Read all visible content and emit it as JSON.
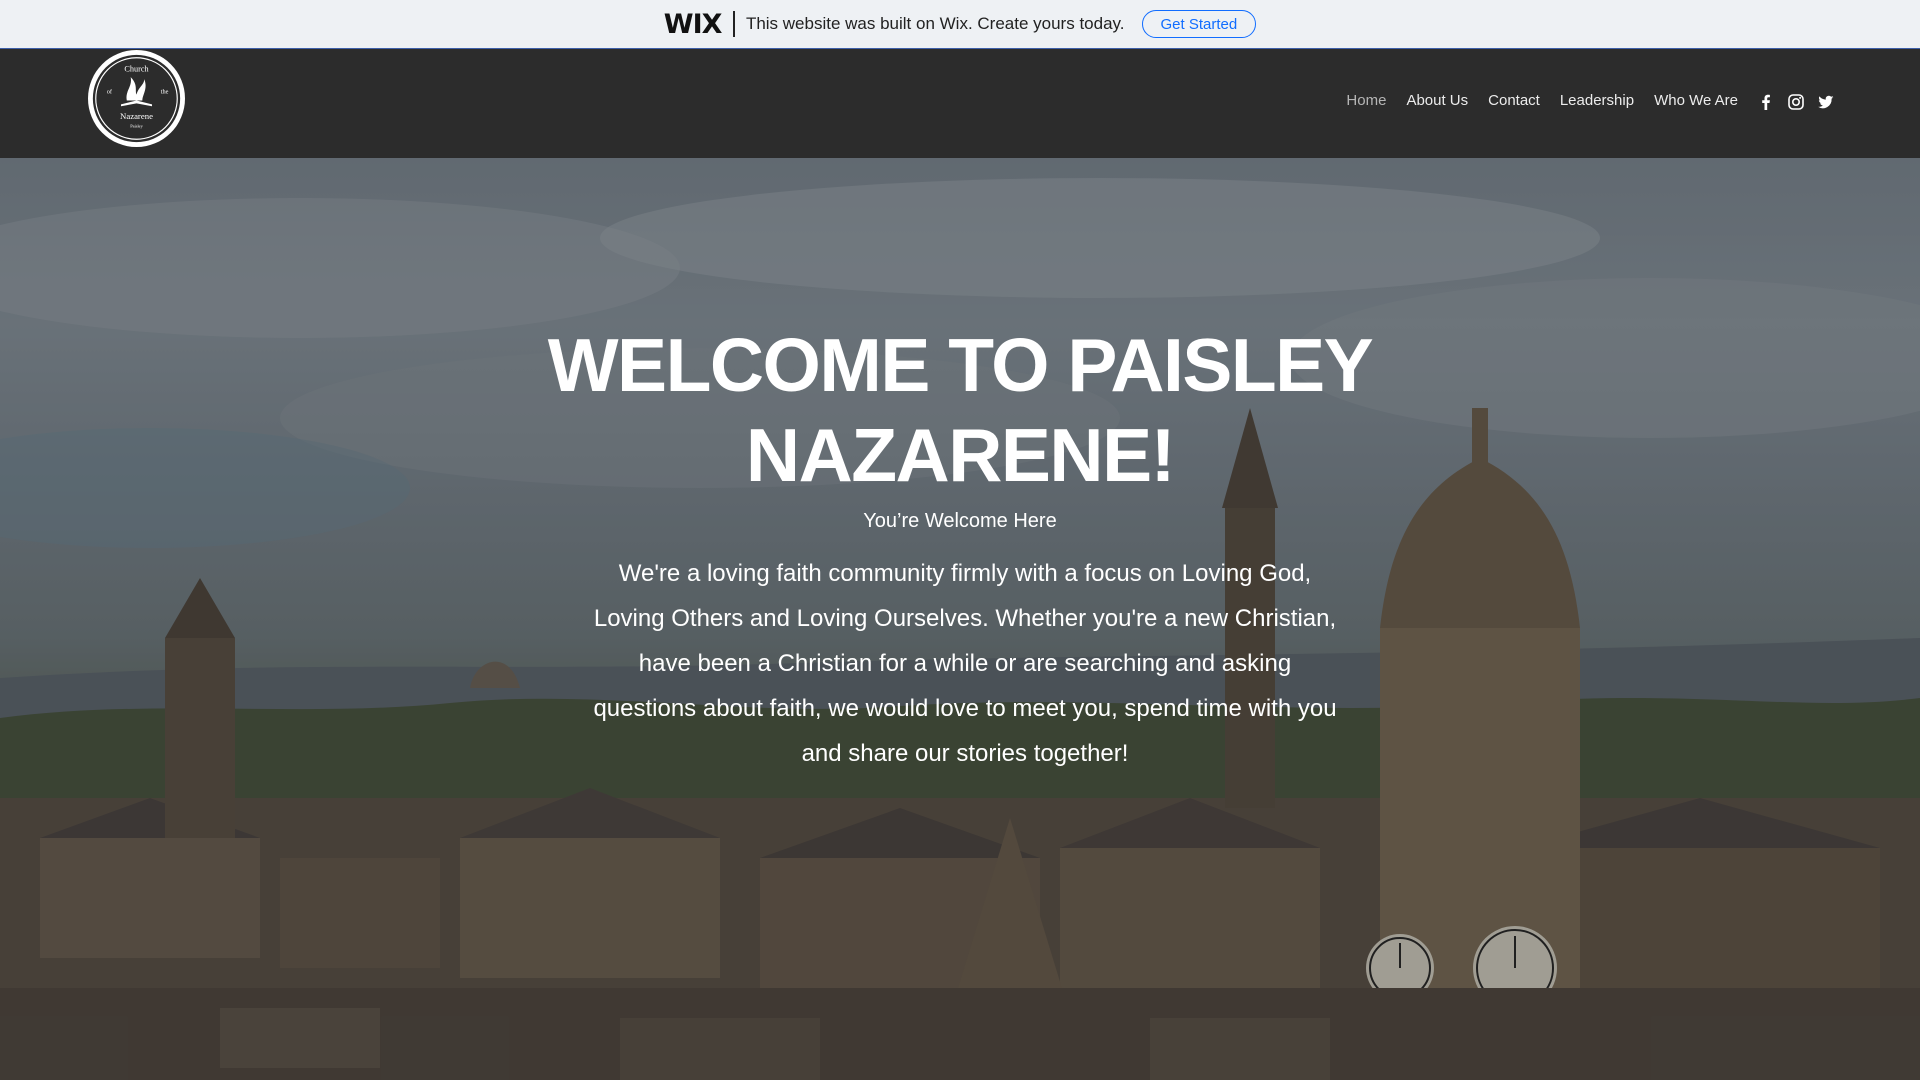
{
  "wix_banner": {
    "logo": "WIX",
    "message": "This website was built on Wix. Create yours today.",
    "cta": "Get Started",
    "accent": "#116dff"
  },
  "header": {
    "logo_text": {
      "line1": "Church",
      "line2_left": "of",
      "line2_right": "the",
      "line3": "Nazarene",
      "line4": "Paisley"
    },
    "nav": [
      "Home",
      "About Us",
      "Contact",
      "Leadership",
      "Who We Are"
    ],
    "active_nav": "Home",
    "social": [
      "facebook-icon",
      "instagram-icon",
      "twitter-icon"
    ]
  },
  "hero": {
    "title": "WELCOME TO PAISLEY NAZARENE!",
    "subtitle": "You’re Welcome Here",
    "body": "We're a loving faith community firmly with a focus on Loving God, Loving Others and Loving Ourselves. Whether you're a new Christian, have been a Christian for a while or are searching and asking questions about faith, we would love to meet you, spend time with you and share our stories together!"
  }
}
